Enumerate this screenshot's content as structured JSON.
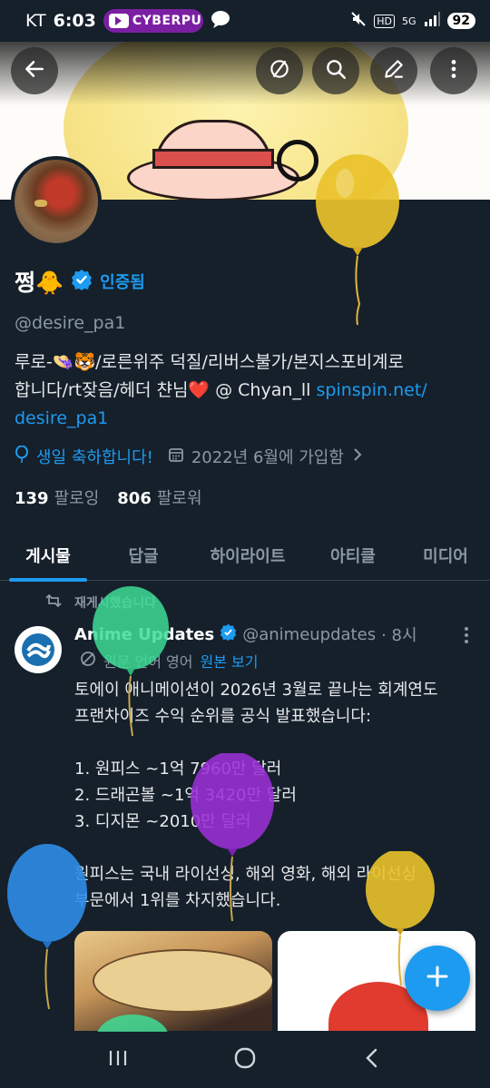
{
  "status_bar": {
    "carrier": "KT",
    "time": "6:03",
    "media_app": "CYBERPU",
    "network": "5G",
    "hd_label": "HD",
    "battery": "92"
  },
  "profile": {
    "name": "쩡🐥",
    "verified_label": "인증됨",
    "handle": "@desire_pa1",
    "bio_line1": "루로-👒🐯/로른위주 덕질/리버스불가/본지스포비계로",
    "bio_line2_prefix": "합니다/rt잦음/헤더 챤님❤️ @ Chyan_ll ",
    "bio_link_part1": "spinspin.net/",
    "bio_link_part2": "desire_pa1",
    "birthday_text": "생일 축하합니다!",
    "joined_text": "2022년 6월에 가입함",
    "following_count": "139",
    "following_label": "팔로잉",
    "followers_count": "806",
    "followers_label": "팔로워"
  },
  "tabs": [
    {
      "label": "게시물",
      "active": true
    },
    {
      "label": "답글",
      "active": false
    },
    {
      "label": "하이라이트",
      "active": false
    },
    {
      "label": "아티클",
      "active": false
    },
    {
      "label": "미디어",
      "active": false
    }
  ],
  "tweet": {
    "repost_label": "재게시했습니다",
    "author_name": "Anime Updates",
    "author_handle": "@animeupdates",
    "time": "· 8시",
    "translated_from": "원문 언어 영어",
    "show_original": "원본 보기",
    "text_lines": [
      "토에이 애니메이션이 2026년 3월로 끝나는 회계연도",
      "프랜차이즈 수익 순위를 공식 발표했습니다:",
      "",
      "1. 원피스 ~1억 7960만 달러",
      "2. 드래곤볼 ~1억 3420만 달러",
      "3. 디지몬 ~2010만 달러",
      "",
      "원피스는 국내 라이선싱, 해외 영화, 해외 라이선싱",
      "부문에서 1위를 차지했습니다."
    ]
  },
  "icons": {
    "back": "arrow-left-icon",
    "hide": "eye-off-icon",
    "search": "search-icon",
    "edit": "pencil-icon",
    "more": "more-vertical-icon",
    "compose": "plus-icon"
  },
  "colors": {
    "background": "#15202b",
    "accent": "#1d9bf0",
    "secondary_text": "#8b98a5",
    "balloon_yellow": "#e9c22a",
    "balloon_green": "#3ddc97",
    "balloon_purple": "#9b2fd6",
    "balloon_blue": "#2e8de8"
  }
}
